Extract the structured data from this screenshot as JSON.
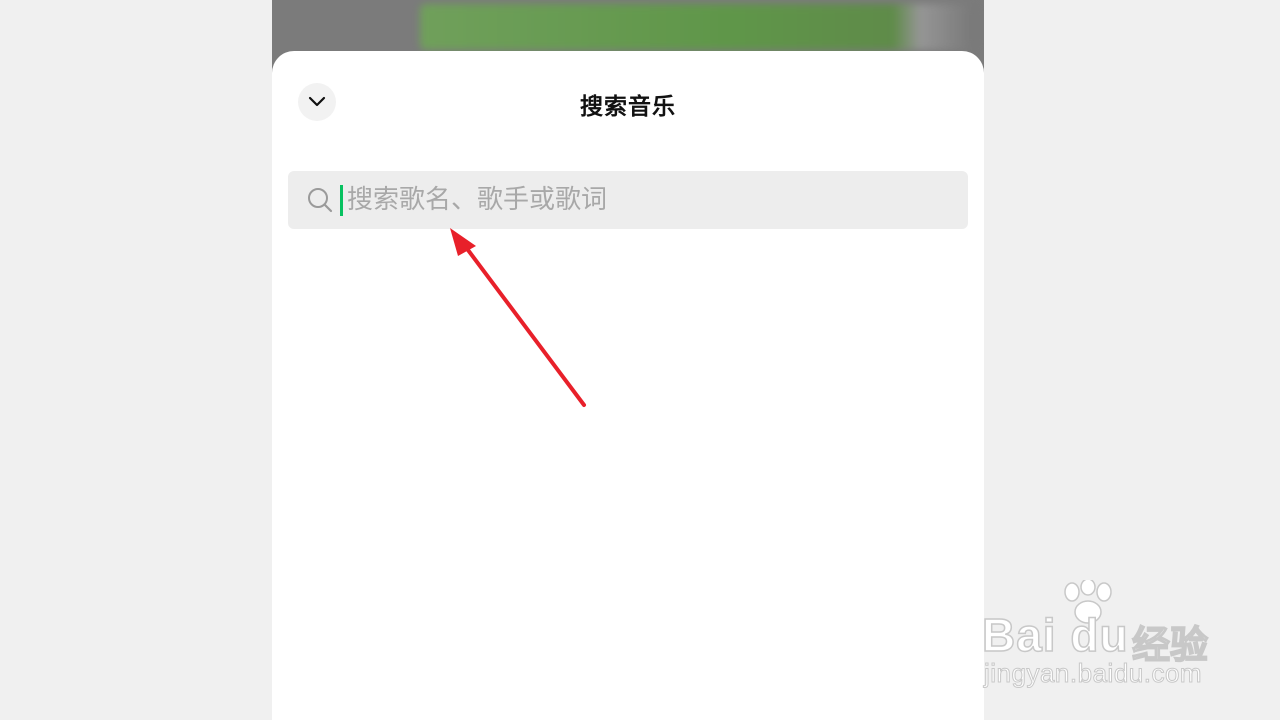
{
  "sheet": {
    "title": "搜索音乐",
    "collapse_icon": "chevron-down-icon"
  },
  "search": {
    "placeholder": "搜索歌名、歌手或歌词",
    "value": "",
    "icon": "search-icon",
    "caret_color": "#07c160"
  },
  "annotation": {
    "arrow_color": "#e8202a",
    "arrow_icon": "red-arrow-icon"
  },
  "watermark": {
    "brand": "Bai du",
    "product": "经验",
    "url": "jingyan.baidu.com",
    "logo_icon": "paw-logo-icon"
  }
}
